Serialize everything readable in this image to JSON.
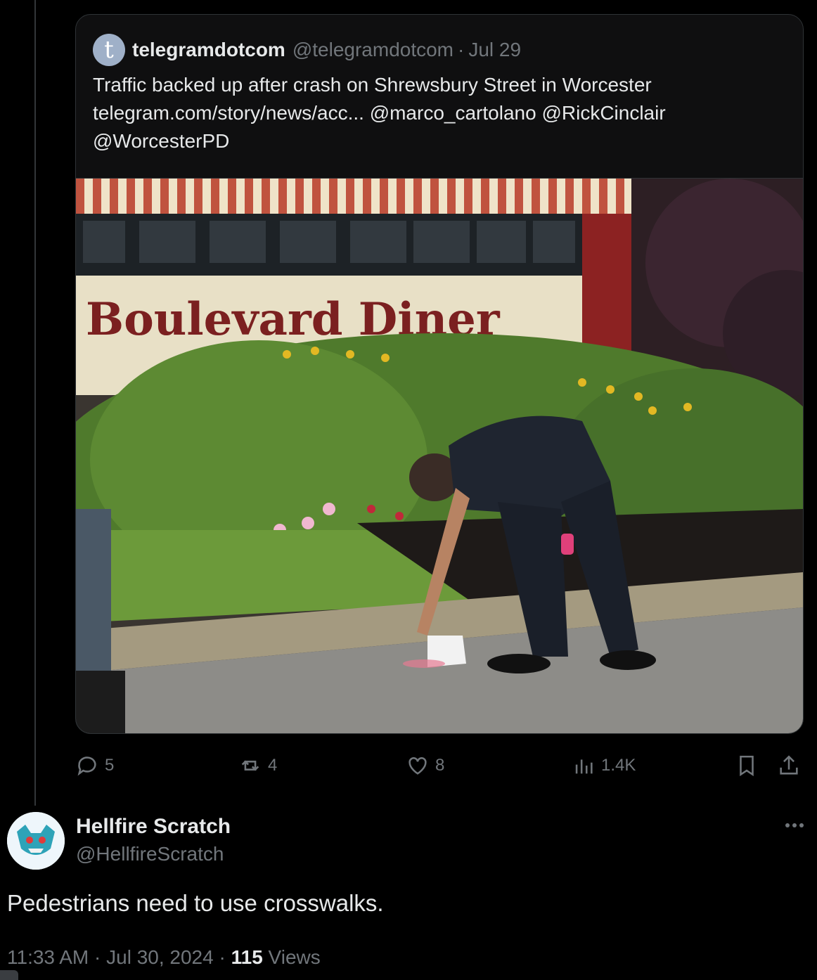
{
  "quoted_tweet": {
    "avatar_letter": "t",
    "name": "telegramdotcom",
    "handle": "@telegramdotcom",
    "separator": "·",
    "date": "Jul 29",
    "text_line1": "Traffic backed up after crash on Shrewsbury Street in Worcester",
    "link": "telegram.com/story/news/acc...",
    "mention1": "@marco_cartolano",
    "mention2": "@RickCinclair",
    "mention3": "@WorcesterPD",
    "image_sign_text": "Boulevard Diner"
  },
  "actions": {
    "replies": "5",
    "reposts": "4",
    "likes": "8",
    "views": "1.4K"
  },
  "reply_tweet": {
    "name": "Hellfire Scratch",
    "handle": "@HellfireScratch",
    "text": "Pedestrians need to use crosswalks.",
    "time": "11:33 AM",
    "date": "Jul 30, 2024",
    "separator": "·",
    "view_count": "115",
    "views_label": "Views"
  }
}
